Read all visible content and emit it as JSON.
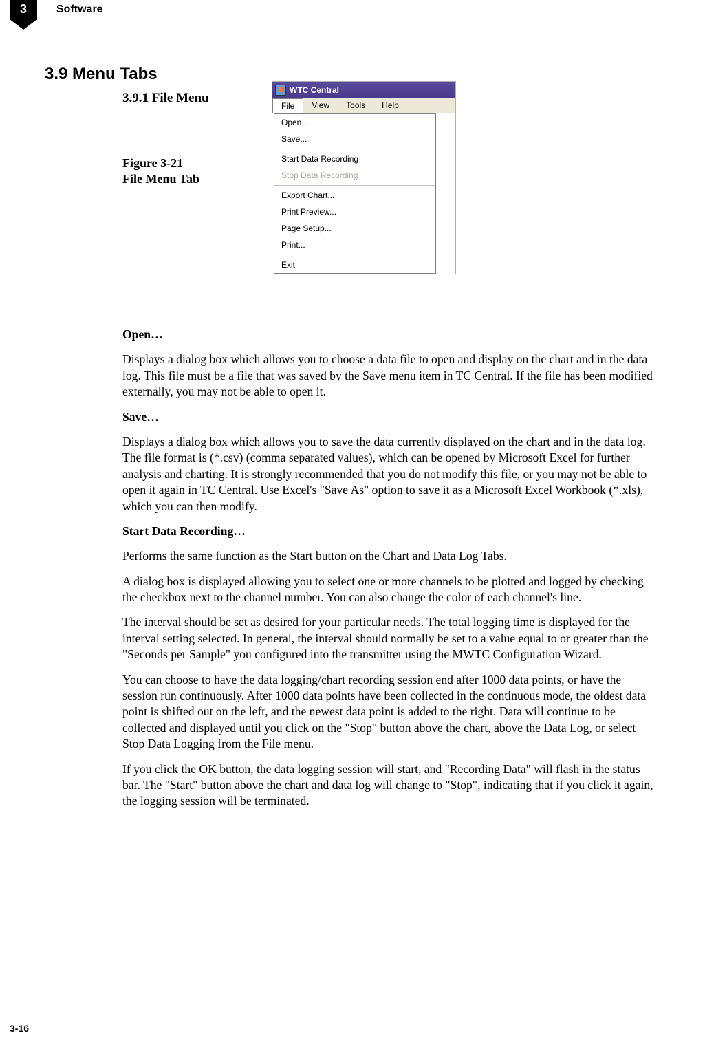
{
  "header": {
    "chapter_num": "3",
    "section_label": "Software"
  },
  "section_title": "3.9 Menu Tabs",
  "subsection_title": "3.9.1 File Menu",
  "figure_label_line1": "Figure 3-21",
  "figure_label_line2": "File Menu Tab",
  "screenshot": {
    "app_title": "WTC Central",
    "menubar": {
      "file": "File",
      "view": "View",
      "tools": "Tools",
      "help": "Help"
    },
    "dropdown": {
      "open": "Open...",
      "save": "Save...",
      "start_rec": "Start Data Recording",
      "stop_rec": "Stop Data Recording",
      "export_chart": "Export Chart...",
      "print_preview": "Print Preview...",
      "page_setup": "Page Setup...",
      "print": "Print...",
      "exit": "Exit"
    }
  },
  "body": {
    "open_head": "Open…",
    "open_text": "Displays a dialog box which allows you to choose a data file to open and display on the chart and in the data log. This file must be a file that was saved by the Save menu item in TC Central. If the file has been modified externally, you may not be able to open it.",
    "save_head": "Save…",
    "save_text": "Displays a dialog box which allows you to save the data currently displayed on the chart and in the data log. The file format is (*.csv) (comma separated values), which can be opened by Microsoft Excel for further analysis and charting. It is strongly recommended that you do not modify this file, or you may not be able to open it again in TC Central.  Use Excel's \"Save As\" option to save it as a Microsoft Excel Workbook (*.xls), which you can then modify.",
    "start_head": "Start Data Recording…",
    "start_p1": "Performs the same function as the Start button on the Chart and Data Log Tabs.",
    "start_p2": "A dialog box is displayed allowing you to select one or more channels to be plotted and logged by checking the checkbox next to the channel number. You can also change the color of each channel's line.",
    "start_p3": "The interval should be set as desired for your particular needs. The total logging time is displayed for the interval setting selected. In general, the interval should normally be set to a value equal to or greater than the \"Seconds per Sample\" you configured into the transmitter using the MWTC Configuration Wizard.",
    "start_p4": "You can choose to have the data logging/chart recording session end after 1000 data points, or have the session run continuously. After 1000 data points have been collected in the continuous mode, the oldest data point is shifted out on the left, and the newest data point is added to the right. Data will continue to be collected and displayed until you click on the \"Stop\" button above the chart, above the Data Log, or select Stop Data Logging from the File menu.",
    "start_p5": "If you click the OK button, the data logging session will start, and \"Recording Data\" will flash in the status bar. The \"Start\" button above the chart and data log will change to \"Stop\", indicating that if you click it again, the logging session will be terminated."
  },
  "page_num": "3-16"
}
